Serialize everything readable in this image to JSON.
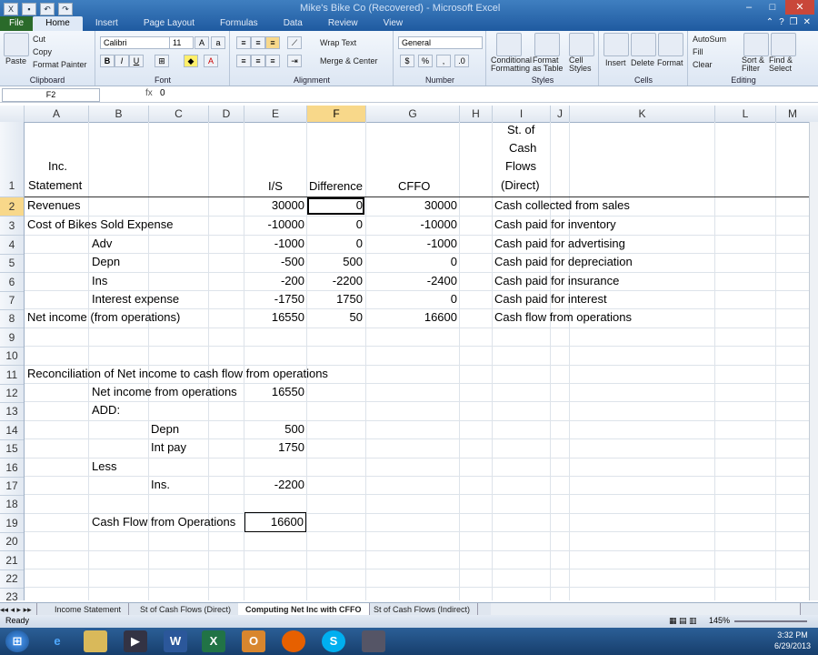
{
  "window": {
    "title": "Mike's Bike Co (Recovered) - Microsoft Excel"
  },
  "ribbon_tabs": [
    "File",
    "Home",
    "Insert",
    "Page Layout",
    "Formulas",
    "Data",
    "Review",
    "View"
  ],
  "clipboard": {
    "paste": "Paste",
    "cut": "Cut",
    "copy": "Copy",
    "format_painter": "Format Painter",
    "label": "Clipboard"
  },
  "font": {
    "name": "Calibri",
    "size": "11",
    "label": "Font"
  },
  "alignment": {
    "wrap": "Wrap Text",
    "merge": "Merge & Center",
    "label": "Alignment"
  },
  "number": {
    "format": "General",
    "label": "Number"
  },
  "styles": {
    "cond": "Conditional Formatting",
    "format_table": "Format as Table",
    "cell_styles": "Cell Styles",
    "label": "Styles"
  },
  "cells": {
    "insert": "Insert",
    "delete": "Delete",
    "format": "Format",
    "label": "Cells"
  },
  "editing": {
    "autosum": "AutoSum",
    "fill": "Fill",
    "clear": "Clear",
    "sort": "Sort & Filter",
    "find": "Find & Select",
    "label": "Editing"
  },
  "formula_bar": {
    "name_box": "F2",
    "fx": "fx",
    "value": "0"
  },
  "columns": [
    "A",
    "B",
    "C",
    "D",
    "E",
    "F",
    "G",
    "H",
    "I",
    "J",
    "K",
    "L",
    "M"
  ],
  "selected_column": "F",
  "selected_row": "2",
  "rows": [
    "1",
    "2",
    "3",
    "4",
    "5",
    "6",
    "7",
    "8",
    "9",
    "10",
    "11",
    "12",
    "13",
    "14",
    "15",
    "16",
    "17",
    "18",
    "19",
    "20",
    "21",
    "22",
    "23"
  ],
  "header_cells": {
    "a1_line1": "Inc.",
    "a1_line2": "Statement",
    "e1": "I/S",
    "f1": "Difference",
    "g1": "CFFO",
    "i1_line1": "St. of",
    "i1_line2": "Cash",
    "i1_line3": "Flows",
    "i1_line4": "(Direct)"
  },
  "table_rows": [
    {
      "label": "Revenues",
      "indent": false,
      "is": "30000",
      "diff": "0",
      "cffo": "30000",
      "cash": "Cash collected from sales"
    },
    {
      "label": "Cost of Bikes Sold Expense",
      "indent": false,
      "is": "-10000",
      "diff": "0",
      "cffo": "-10000",
      "cash": "Cash paid for inventory"
    },
    {
      "label": "Adv",
      "indent": true,
      "is": "-1000",
      "diff": "0",
      "cffo": "-1000",
      "cash": "Cash paid for advertising"
    },
    {
      "label": "Depn",
      "indent": true,
      "is": "-500",
      "diff": "500",
      "cffo": "0",
      "cash": "Cash paid for depreciation"
    },
    {
      "label": "Ins",
      "indent": true,
      "is": "-200",
      "diff": "-2200",
      "cffo": "-2400",
      "cash": "Cash paid for insurance"
    },
    {
      "label": "Interest expense",
      "indent": true,
      "is": "-1750",
      "diff": "1750",
      "cffo": "0",
      "cash": "Cash paid for interest"
    },
    {
      "label": "Net income (from operations)",
      "indent": false,
      "is": "16550",
      "diff": "50",
      "cffo": "16600",
      "cash": "Cash flow from operations"
    }
  ],
  "reconciliation": {
    "title": "Reconciliation of Net income to cash flow from operations",
    "ni_label": "Net income from operations",
    "ni_value": "16550",
    "add": "ADD:",
    "depn_label": "Depn",
    "depn_value": "500",
    "intpay_label": "Int pay",
    "intpay_value": "1750",
    "less": "Less",
    "ins_label": "Ins.",
    "ins_value": "-2200",
    "cf_label": "Cash Flow from Operations",
    "cf_value": "16600"
  },
  "sheet_tabs": [
    "Income Statement",
    "St of Cash Flows (Direct)",
    "Computing Net Inc with CFFO",
    "St of Cash Flows (Indirect)"
  ],
  "active_sheet": "Computing Net Inc with CFFO",
  "status": {
    "ready": "Ready",
    "zoom": "145%"
  },
  "taskbar": {
    "time": "3:32 PM",
    "date": "6/29/2013"
  }
}
